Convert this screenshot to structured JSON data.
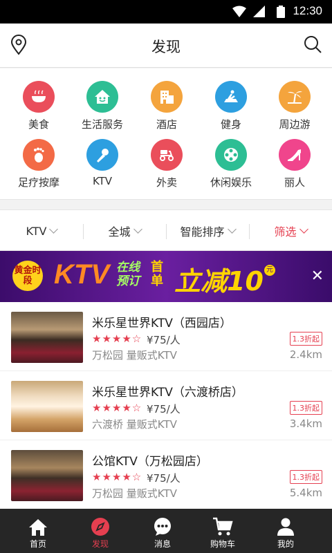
{
  "status": {
    "time": "12:30"
  },
  "header": {
    "title": "发现"
  },
  "categories": [
    {
      "label": "美食",
      "color": "#ea4e5b",
      "icon": "food-icon"
    },
    {
      "label": "生活服务",
      "color": "#2dbe94",
      "icon": "life-service-icon"
    },
    {
      "label": "酒店",
      "color": "#f4a43d",
      "icon": "hotel-icon"
    },
    {
      "label": "健身",
      "color": "#2d9fe0",
      "icon": "fitness-icon"
    },
    {
      "label": "周边游",
      "color": "#f4a43d",
      "icon": "travel-icon"
    },
    {
      "label": "足疗按摩",
      "color": "#f36a46",
      "icon": "foot-massage-icon"
    },
    {
      "label": "KTV",
      "color": "#2d9fe0",
      "icon": "microphone-icon"
    },
    {
      "label": "外卖",
      "color": "#ea4e5b",
      "icon": "scooter-icon"
    },
    {
      "label": "休闲娱乐",
      "color": "#2dbe94",
      "icon": "film-reel-icon"
    },
    {
      "label": "丽人",
      "color": "#f0458c",
      "icon": "high-heel-icon"
    }
  ],
  "filters": [
    {
      "label": "KTV"
    },
    {
      "label": "全城"
    },
    {
      "label": "智能排序"
    },
    {
      "label": "筛选"
    }
  ],
  "banner": {
    "badge": "黄金时段",
    "ktv": "KTV",
    "online_line1": "在线",
    "online_line2": "预订",
    "shou_line1": "首",
    "shou_line2": "单",
    "lijian": "立减10",
    "yuan": "元"
  },
  "shops": [
    {
      "name": "米乐星世界KTV（西园店）",
      "stars": "★★★★☆",
      "price": "¥75/人",
      "area": "万松园 量贩式KTV",
      "discount": "1.3折起",
      "distance": "2.4km"
    },
    {
      "name": "米乐星世界KTV（六渡桥店）",
      "stars": "★★★★☆",
      "price": "¥75/人",
      "area": "六渡桥 量贩式KTV",
      "discount": "1.3折起",
      "distance": "3.4km"
    },
    {
      "name": "公馆KTV（万松园店）",
      "stars": "★★★★☆",
      "price": "¥75/人",
      "area": "万松园 量贩式KTV",
      "discount": "1.3折起",
      "distance": "5.4km"
    }
  ],
  "tabs": [
    {
      "label": "首页",
      "icon": "home-icon"
    },
    {
      "label": "发现",
      "icon": "compass-icon"
    },
    {
      "label": "消息",
      "icon": "message-icon"
    },
    {
      "label": "购物车",
      "icon": "cart-icon"
    },
    {
      "label": "我的",
      "icon": "user-icon"
    }
  ]
}
